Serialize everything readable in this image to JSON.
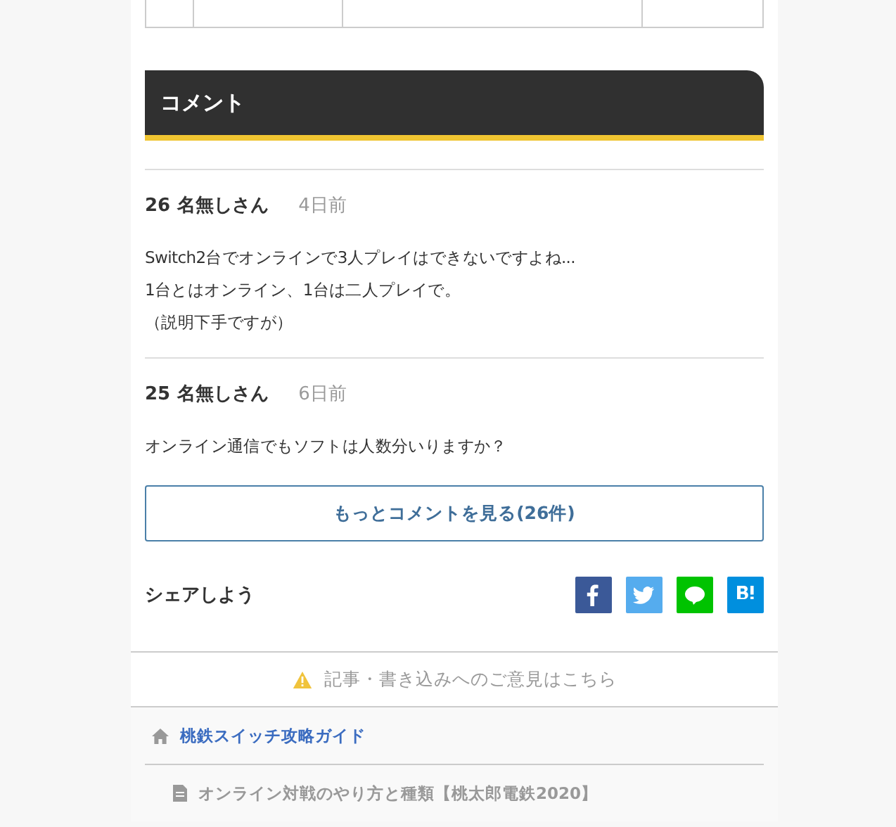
{
  "comments_section": {
    "title": "コメント",
    "comments": [
      {
        "number": "26",
        "name": "名無しさん",
        "time": "4日前",
        "lines": [
          "Switch2台でオンラインで3人プレイはできないですよね...",
          "1台とはオンライン、1台は二人プレイで。",
          "（説明下手ですが）"
        ]
      },
      {
        "number": "25",
        "name": "名無しさん",
        "time": "6日前",
        "lines": [
          "オンライン通信でもソフトは人数分いりますか？"
        ]
      }
    ],
    "more_button": "もっとコメントを見る(26件)"
  },
  "share": {
    "label": "シェアしよう",
    "buttons": [
      {
        "kind": "facebook"
      },
      {
        "kind": "twitter"
      },
      {
        "kind": "line"
      },
      {
        "kind": "hatena"
      }
    ]
  },
  "feedback_link": "記事・書き込みへのご意見はこちら",
  "breadcrumb": [
    {
      "kind": "home",
      "label": "桃鉄スイッチ攻略ガイド"
    },
    {
      "kind": "page",
      "label": "オンライン対戦のやり方と種類【桃太郎電鉄2020】"
    }
  ]
}
